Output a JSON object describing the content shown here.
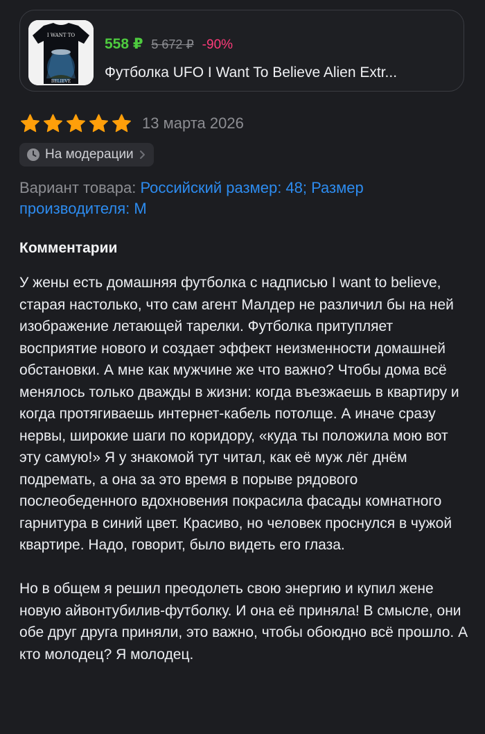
{
  "product": {
    "image_text_top": "I WANT TO",
    "image_text_bottom": "BELIEVE",
    "price_current": "558 ₽",
    "price_old": "5 672 ₽",
    "discount": "-90%",
    "title": "Футболка UFO I Want To Believe Alien Extr..."
  },
  "review": {
    "rating": 5,
    "rating_max": 5,
    "date": "13 марта 2026",
    "status": "На модерации",
    "variant_label": "Вариант товара: ",
    "variant_value": "Российский размер: 48; Размер производителя: M",
    "comments_heading": "Комментарии",
    "comment_paragraph_1": "У жены есть домашняя футболка с надписью I want to believe, старая настолько, что сам агент Малдер не различил бы на ней изображение летающей тарелки. Футболка притупляет восприятие нового и создает эффект неизменности домашней обстановки. А мне как мужчине же что важно? Чтобы дома всё менялось только дважды в жизни: когда въезжаешь в квартиру и когда протягиваешь интернет-кабель потолще. А иначе сразу нервы, широкие шаги по коридору, «куда ты положила мою вот эту самую!»  Я у знакомой тут читал, как её муж лёг днём подремать, а она за это время в порыве рядового послеобеденного вдохновения покрасила фасады комнатного гарнитура в синий цвет. Красиво, но человек проснулся в чужой квартире. Надо, говорит, было видеть его глаза.",
    "comment_paragraph_2": "Но в общем я решил преодолеть свою энергию и купил жене новую айвонтубилив-футболку. И она её приняла! В смысле, они обе друг друга приняли, это важно, чтобы обоюдно всё прошло. А кто молодец? Я молодец."
  },
  "icons": {
    "star": "star-icon",
    "status": "clock-icon",
    "chevron": "chevron-right-icon"
  },
  "colors": {
    "background": "#1c1d21",
    "price_current": "#4ecb3f",
    "discount": "#ff3b7a",
    "star": "#ff9f0a",
    "link": "#2d8cf0"
  }
}
